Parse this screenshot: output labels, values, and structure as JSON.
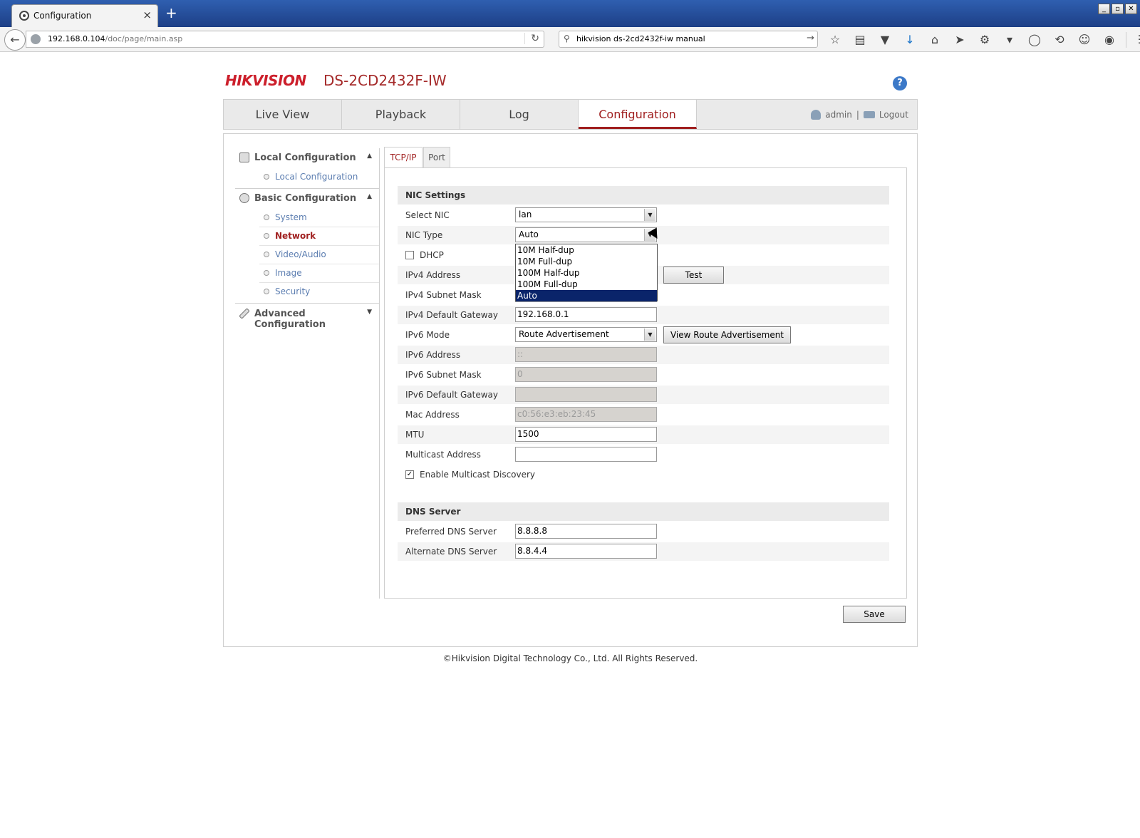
{
  "browser": {
    "tab_title": "Configuration",
    "tab_close": "×",
    "new_tab": "+",
    "url_host": "192.168.0.104",
    "url_path": "/doc/page/main.asp",
    "search_text": "hikvision ds-2cd2432f-iw manual",
    "window_controls": [
      "_",
      "▫",
      "✕"
    ],
    "toolbar_icons": [
      "star-icon",
      "reader-icon",
      "pocket-icon",
      "download-icon",
      "home-icon",
      "send-icon",
      "plugin-icon",
      "chevron-icon",
      "sync-icon",
      "refresh-circle-icon",
      "chat-icon",
      "extension-icon",
      "menu-icon"
    ]
  },
  "header": {
    "brand": "HIKVISION",
    "model": "DS-2CD2432F-IW",
    "help": "?"
  },
  "topnav": {
    "items": [
      "Live View",
      "Playback",
      "Log",
      "Configuration"
    ],
    "active": "Configuration",
    "user": "admin",
    "separator": "|",
    "logout": "Logout"
  },
  "sidebar": {
    "local": {
      "label": "Local Configuration",
      "items": [
        "Local Configuration"
      ]
    },
    "basic": {
      "label": "Basic Configuration",
      "items": [
        "System",
        "Network",
        "Video/Audio",
        "Image",
        "Security"
      ]
    },
    "advanced": {
      "label": "Advanced Configuration"
    },
    "active_item": "Network"
  },
  "tabs": [
    "TCP/IP",
    "Port"
  ],
  "nic_settings": {
    "header": "NIC Settings",
    "select_nic_label": "Select NIC",
    "select_nic_value": "lan",
    "nic_type_label": "NIC Type",
    "nic_type_value": "Auto",
    "nic_type_options": [
      "10M Half-dup",
      "10M Full-dup",
      "100M Half-dup",
      "100M Full-dup",
      "Auto"
    ],
    "dhcp_label": "DHCP",
    "ipv4_address_label": "IPv4 Address",
    "test_button": "Test",
    "ipv4_mask_label": "IPv4 Subnet Mask",
    "ipv4_gateway_label": "IPv4 Default Gateway",
    "ipv4_gateway_value": "192.168.0.1",
    "ipv6_mode_label": "IPv6 Mode",
    "ipv6_mode_value": "Route Advertisement",
    "view_ra_button": "View Route Advertisement",
    "ipv6_address_label": "IPv6 Address",
    "ipv6_address_value": "::",
    "ipv6_mask_label": "IPv6 Subnet Mask",
    "ipv6_mask_value": "0",
    "ipv6_gateway_label": "IPv6 Default Gateway",
    "ipv6_gateway_value": "",
    "mac_label": "Mac Address",
    "mac_value": "c0:56:e3:eb:23:45",
    "mtu_label": "MTU",
    "mtu_value": "1500",
    "multicast_label": "Multicast Address",
    "multicast_value": "",
    "multicast_discovery_label": "Enable Multicast Discovery",
    "check_mark": "✓"
  },
  "dns": {
    "header": "DNS Server",
    "preferred_label": "Preferred DNS Server",
    "preferred_value": "8.8.8.8",
    "alternate_label": "Alternate DNS Server",
    "alternate_value": "8.8.4.4"
  },
  "save_button": "Save",
  "footer": "©Hikvision Digital Technology Co., Ltd. All Rights Reserved."
}
